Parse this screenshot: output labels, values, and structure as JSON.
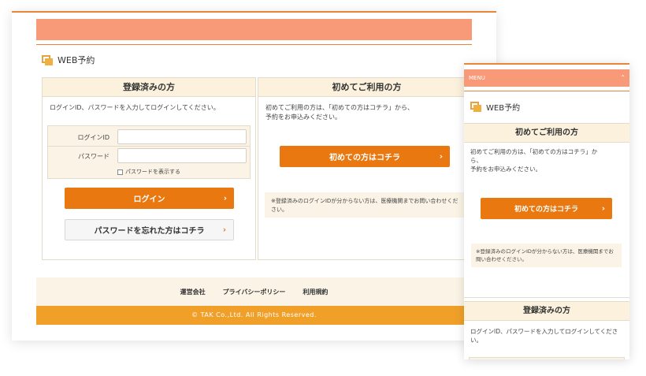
{
  "desktop": {
    "header": {
      "title": "WEB予約"
    },
    "login": {
      "title": "登録済みの方",
      "description": "ログインID、パスワードを入力してログインしてください。",
      "id_label": "ログインID",
      "password_label": "パスワード",
      "id_value": "",
      "password_value": "",
      "show_password": "パスワードを表示する",
      "login_button": "ログイン",
      "forgot_button": "パスワードを忘れた方はコチラ"
    },
    "first": {
      "title": "初めてご利用の方",
      "description_line1": "初めてご利用の方は、「初めての方はコチラ」から、",
      "description_line2": "予約をお申込みください。",
      "button": "初めての方はコチラ",
      "note": "※登録済みのログインIDが分からない方は、医療機関までお問い合わせください。"
    },
    "footer": {
      "links": [
        "運営会社",
        "プライバシーポリシー",
        "利用規約"
      ],
      "copyright": "© TAK Co.,Ltd. All Rights Reserved."
    }
  },
  "mobile": {
    "menu_label": "MENU",
    "header": {
      "title": "WEB予約"
    },
    "first": {
      "title": "初めてご利用の方",
      "description_line1": "初めてご利用の方は、「初めての方はコチラ」か",
      "description_line2": "ら、",
      "description_line3": "予約をお申込みください。",
      "button": "初めての方はコチラ",
      "note": "※登録済みのログインIDが分からない方は、医療機関までお問い合わせください。"
    },
    "login": {
      "title": "登録済みの方",
      "description": "ログインID、パスワードを入力してログインしてください。"
    }
  },
  "colors": {
    "accent_orange": "#e8780f",
    "header_salmon": "#f89a78",
    "footer_gold": "#f0a028",
    "panel_cream": "#fbf1dc"
  },
  "icons": {
    "web_icon": "web-reservation-icon",
    "arrow": "chevron-right-icon",
    "menu_toggle": "chevron-up-icon"
  }
}
